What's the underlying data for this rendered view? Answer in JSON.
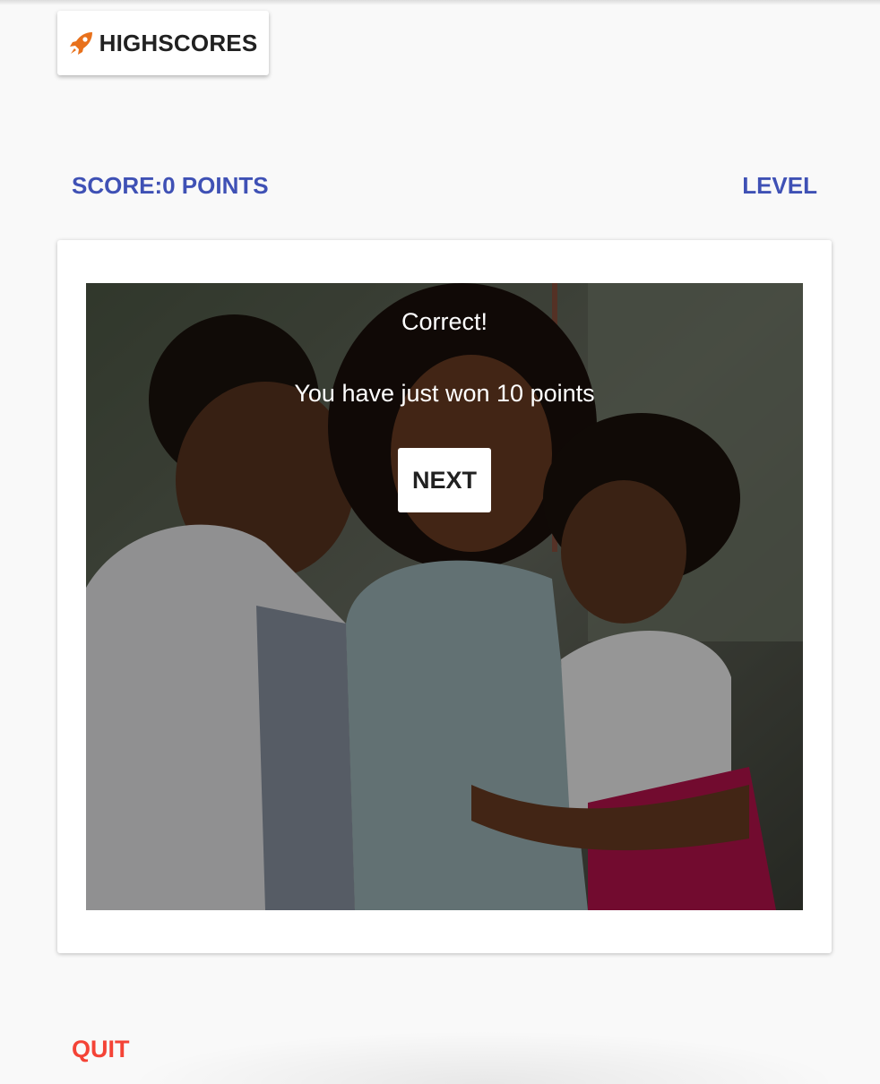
{
  "header": {
    "highscores_label": "HIGHSCORES",
    "highscores_icon": "rocket-icon",
    "icon_color": "#e8711c"
  },
  "status": {
    "score_label": "SCORE:0 POINTS",
    "level_label": "LEVEL"
  },
  "result": {
    "title": "Correct!",
    "message": "You have just won 10 points",
    "next_label": "NEXT"
  },
  "footer": {
    "quit_label": "QUIT"
  },
  "colors": {
    "accent": "#3f51b5",
    "quit": "#f44336",
    "background": "#f9f9f9"
  }
}
